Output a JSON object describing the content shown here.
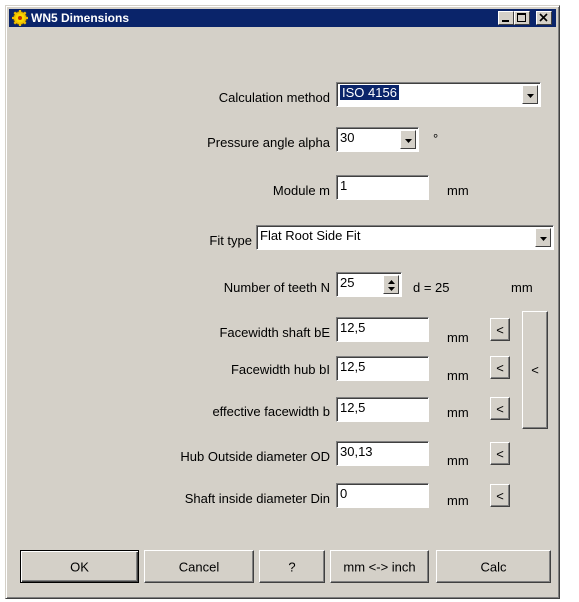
{
  "window": {
    "title": "WN5 Dimensions"
  },
  "calc_method": {
    "label": "Calculation method",
    "value": "ISO 4156"
  },
  "pressure_angle": {
    "label": "Pressure angle alpha",
    "value": "30",
    "unit": "°"
  },
  "module": {
    "label": "Module m",
    "value": "1",
    "unit": "mm"
  },
  "fit_type": {
    "label": "Fit type",
    "value": "Flat Root Side Fit"
  },
  "teeth": {
    "label": "Number of teeth N",
    "value": "25",
    "d_text": "d = 25",
    "unit": "mm"
  },
  "facewidth_shaft": {
    "label": "Facewidth shaft bE",
    "value": "12,5",
    "unit": "mm",
    "button": "<"
  },
  "facewidth_hub": {
    "label": "Facewidth hub bI",
    "value": "12,5",
    "unit": "mm",
    "button": "<"
  },
  "effective_facewidth": {
    "label": "effective facewidth b",
    "value": "12,5",
    "unit": "mm",
    "button": "<"
  },
  "combined_button": "<",
  "hub_od": {
    "label": "Hub Outside diameter OD",
    "value": "30,13",
    "unit": "mm",
    "button": "<"
  },
  "shaft_din": {
    "label": "Shaft inside diameter  Din",
    "value": "0",
    "unit": "mm",
    "button": "<"
  },
  "buttons": {
    "ok": "OK",
    "cancel": "Cancel",
    "help": "?",
    "units": "mm <-> inch",
    "calc": "Calc"
  },
  "colors": {
    "face": "#d4d0c8",
    "title_bar": "#0a246a",
    "selection": "#0a246a"
  }
}
